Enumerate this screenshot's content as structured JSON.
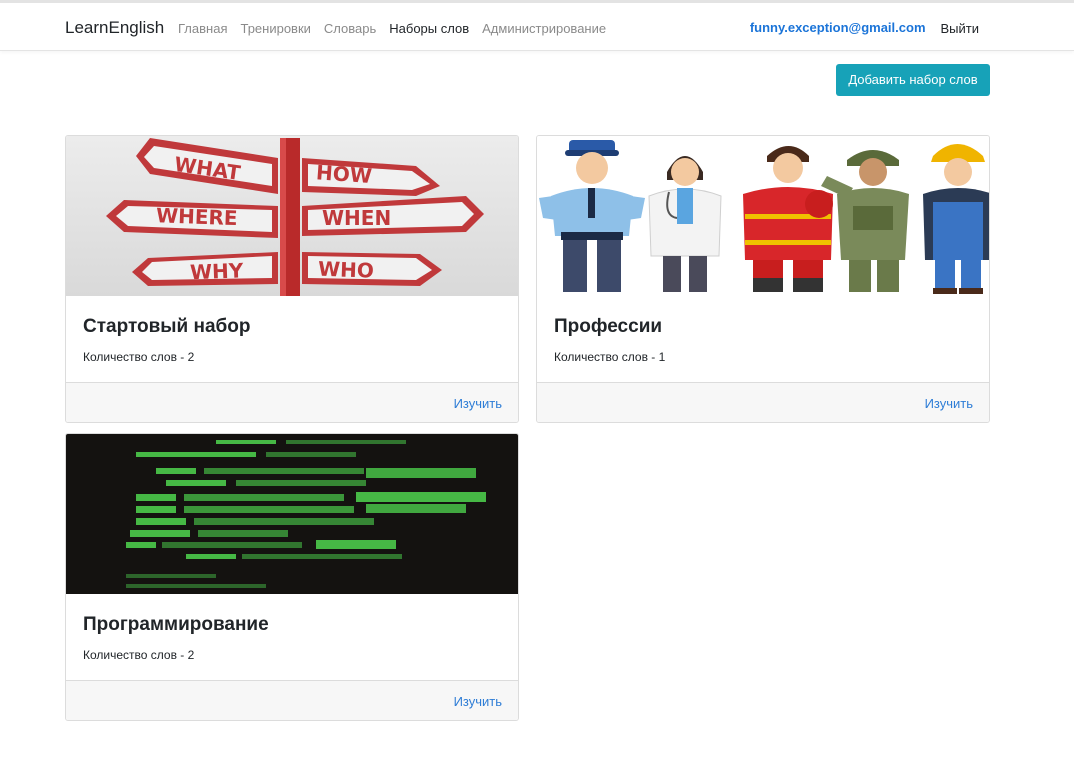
{
  "navbar": {
    "brand": "LearnEnglish",
    "links": [
      {
        "label": "Главная"
      },
      {
        "label": "Тренировки"
      },
      {
        "label": "Словарь"
      },
      {
        "label": "Наборы слов"
      },
      {
        "label": "Администрирование"
      }
    ],
    "user_email": "funny.exception@gmail.com",
    "logout_label": "Выйти"
  },
  "actions": {
    "add_set_label": "Добавить набор слов"
  },
  "sets": [
    {
      "title": "Стартовый набор",
      "count_text": "Количество слов - 2",
      "study_label": "Изучить",
      "image": {
        "signs": [
          "WHAT",
          "HOW",
          "WHERE",
          "WHEN",
          "WHY",
          "WHO"
        ]
      }
    },
    {
      "title": "Профессии",
      "count_text": "Количество слов - 1",
      "study_label": "Изучить"
    },
    {
      "title": "Программирование",
      "count_text": "Количество слов - 2",
      "study_label": "Изучить"
    }
  ],
  "colors": {
    "accent": "#17a2b8",
    "link": "#2e7dd6",
    "email": "#1b74d8"
  }
}
